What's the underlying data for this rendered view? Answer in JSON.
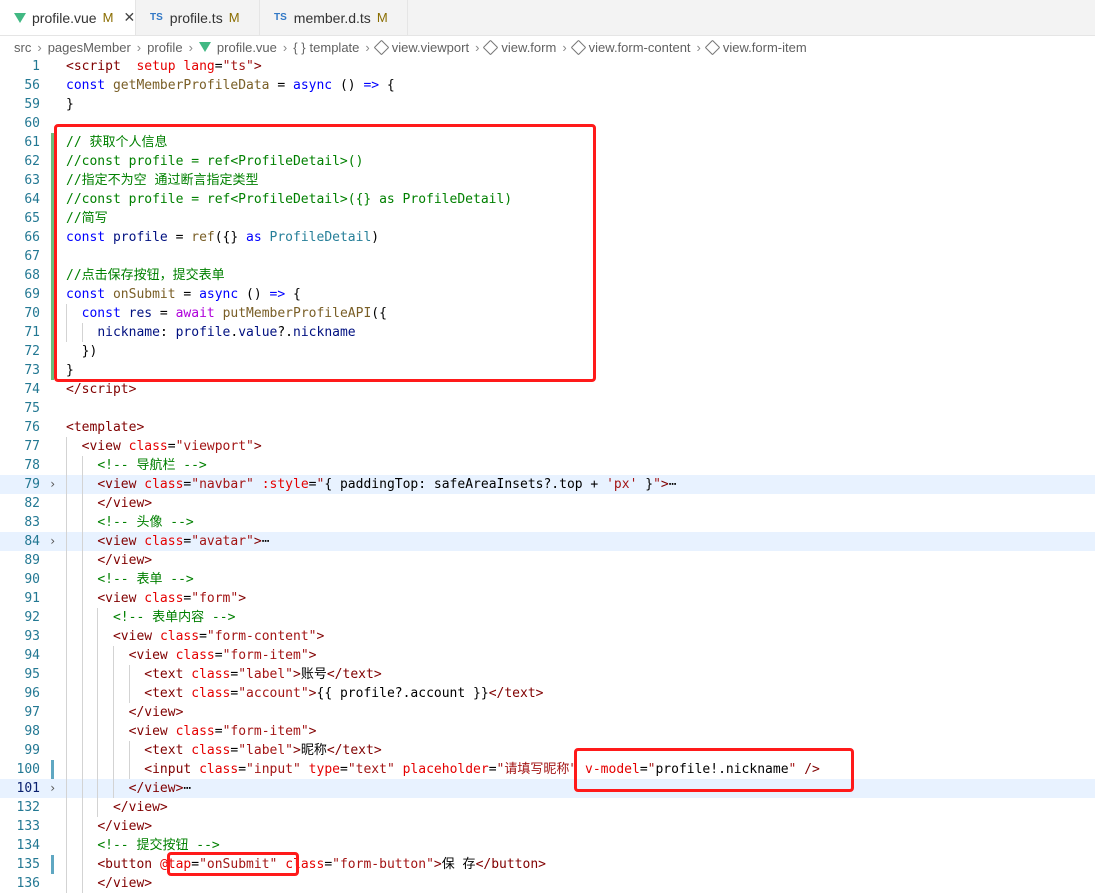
{
  "tabs": [
    {
      "label": "profile.vue",
      "status": "M",
      "icon": "vue-icon",
      "active": true
    },
    {
      "label": "profile.ts",
      "status": "M",
      "icon": "ts-icon",
      "active": false
    },
    {
      "label": "member.d.ts",
      "status": "M",
      "icon": "ts-icon",
      "active": false
    }
  ],
  "close_glyph": "✕",
  "breadcrumb": [
    "src",
    "pagesMember",
    "profile",
    "profile.vue",
    "template",
    "view.viewport",
    "view.form",
    "view.form-content",
    "view.form-item"
  ],
  "lines": [
    {
      "n": "1",
      "t": [
        [
          "tag",
          "<"
        ],
        [
          "tag",
          "script"
        ],
        [
          "",
          "  "
        ],
        [
          "attr",
          "setup"
        ],
        [
          "",
          " "
        ],
        [
          "attr",
          "lang"
        ],
        [
          "",
          "="
        ],
        [
          "str",
          "\"ts\""
        ],
        [
          "tag",
          ">"
        ]
      ]
    },
    {
      "n": "56",
      "t": [
        [
          "kw",
          "const"
        ],
        [
          "",
          " "
        ],
        [
          "fn",
          "getMemberProfileData"
        ],
        [
          "",
          " = "
        ],
        [
          "kw",
          "async"
        ],
        [
          "",
          " () "
        ],
        [
          "kw",
          "=>"
        ],
        [
          "",
          " {"
        ]
      ]
    },
    {
      "n": "59",
      "t": [
        [
          "",
          "}"
        ]
      ]
    },
    {
      "n": "60",
      "t": []
    },
    {
      "n": "61",
      "t": [
        [
          "cm",
          "// 获取个人信息"
        ]
      ]
    },
    {
      "n": "62",
      "t": [
        [
          "cm",
          "//const profile = ref<ProfileDetail>()"
        ]
      ]
    },
    {
      "n": "63",
      "t": [
        [
          "cm",
          "//指定不为空 通过断言指定类型"
        ]
      ]
    },
    {
      "n": "64",
      "t": [
        [
          "cm",
          "//const profile = ref<ProfileDetail>({} as ProfileDetail)"
        ]
      ]
    },
    {
      "n": "65",
      "t": [
        [
          "cm",
          "//简写"
        ]
      ]
    },
    {
      "n": "66",
      "t": [
        [
          "kw",
          "const"
        ],
        [
          "",
          " "
        ],
        [
          "va",
          "profile"
        ],
        [
          "",
          " = "
        ],
        [
          "fn",
          "ref"
        ],
        [
          "",
          "({} "
        ],
        [
          "kw",
          "as"
        ],
        [
          "",
          " "
        ],
        [
          "ty",
          "ProfileDetail"
        ],
        [
          "",
          ")"
        ]
      ]
    },
    {
      "n": "67",
      "t": []
    },
    {
      "n": "68",
      "t": [
        [
          "cm",
          "//点击保存按钮，提交表单"
        ]
      ]
    },
    {
      "n": "69",
      "t": [
        [
          "kw",
          "const"
        ],
        [
          "",
          " "
        ],
        [
          "fn",
          "onSubmit"
        ],
        [
          "",
          " = "
        ],
        [
          "kw",
          "async"
        ],
        [
          "",
          " () "
        ],
        [
          "kw",
          "=>"
        ],
        [
          "",
          " {"
        ]
      ]
    },
    {
      "n": "70",
      "t": [
        [
          "",
          "  "
        ],
        [
          "kw",
          "const"
        ],
        [
          "",
          " "
        ],
        [
          "va",
          "res"
        ],
        [
          "",
          " = "
        ],
        [
          "ctl",
          "await"
        ],
        [
          "",
          " "
        ],
        [
          "fn",
          "putMemberProfileAPI"
        ],
        [
          "",
          "({"
        ]
      ]
    },
    {
      "n": "71",
      "t": [
        [
          "",
          "    "
        ],
        [
          "va",
          "nickname"
        ],
        [
          "",
          ": "
        ],
        [
          "va",
          "profile"
        ],
        [
          "",
          "."
        ],
        [
          "va",
          "value"
        ],
        [
          "",
          "?."
        ],
        [
          "va",
          "nickname"
        ]
      ]
    },
    {
      "n": "72",
      "t": [
        [
          "",
          "  })"
        ]
      ]
    },
    {
      "n": "73",
      "t": [
        [
          "",
          "}"
        ]
      ]
    },
    {
      "n": "74",
      "t": [
        [
          "tag",
          "</"
        ],
        [
          "tag",
          "script"
        ],
        [
          "tag",
          ">"
        ]
      ]
    },
    {
      "n": "75",
      "t": []
    },
    {
      "n": "76",
      "t": [
        [
          "tag",
          "<template>"
        ]
      ]
    },
    {
      "n": "77",
      "t": [
        [
          "",
          "  "
        ],
        [
          "tag",
          "<view"
        ],
        [
          "",
          " "
        ],
        [
          "attr",
          "class"
        ],
        [
          "",
          "="
        ],
        [
          "str",
          "\"viewport\""
        ],
        [
          "tag",
          ">"
        ]
      ]
    },
    {
      "n": "78",
      "t": [
        [
          "",
          "    "
        ],
        [
          "cm",
          "<!-- 导航栏 -->"
        ]
      ]
    },
    {
      "n": "79",
      "t": [
        [
          "",
          "    "
        ],
        [
          "tag",
          "<view"
        ],
        [
          "",
          " "
        ],
        [
          "attr",
          "class"
        ],
        [
          "",
          "="
        ],
        [
          "str",
          "\"navbar\""
        ],
        [
          "",
          " "
        ],
        [
          "attr",
          ":style"
        ],
        [
          "",
          "="
        ],
        [
          "str",
          "\""
        ],
        [
          "",
          "{ paddingTop: safeAreaInsets?.top + "
        ],
        [
          "str",
          "'px'"
        ],
        [
          "",
          " }"
        ],
        [
          "str",
          "\""
        ],
        [
          "tag",
          ">"
        ],
        [
          "",
          "⋯"
        ]
      ]
    },
    {
      "n": "82",
      "t": [
        [
          "",
          "    "
        ],
        [
          "tag",
          "</view>"
        ]
      ]
    },
    {
      "n": "83",
      "t": [
        [
          "",
          "    "
        ],
        [
          "cm",
          "<!-- 头像 -->"
        ]
      ]
    },
    {
      "n": "84",
      "t": [
        [
          "",
          "    "
        ],
        [
          "tag",
          "<view"
        ],
        [
          "",
          " "
        ],
        [
          "attr",
          "class"
        ],
        [
          "",
          "="
        ],
        [
          "str",
          "\"avatar\""
        ],
        [
          "tag",
          ">"
        ],
        [
          "",
          "⋯"
        ]
      ]
    },
    {
      "n": "89",
      "t": [
        [
          "",
          "    "
        ],
        [
          "tag",
          "</view>"
        ]
      ]
    },
    {
      "n": "90",
      "t": [
        [
          "",
          "    "
        ],
        [
          "cm",
          "<!-- 表单 -->"
        ]
      ]
    },
    {
      "n": "91",
      "t": [
        [
          "",
          "    "
        ],
        [
          "tag",
          "<view"
        ],
        [
          "",
          " "
        ],
        [
          "attr",
          "class"
        ],
        [
          "",
          "="
        ],
        [
          "str",
          "\"form\""
        ],
        [
          "tag",
          ">"
        ]
      ]
    },
    {
      "n": "92",
      "t": [
        [
          "",
          "      "
        ],
        [
          "cm",
          "<!-- 表单内容 -->"
        ]
      ]
    },
    {
      "n": "93",
      "t": [
        [
          "",
          "      "
        ],
        [
          "tag",
          "<view"
        ],
        [
          "",
          " "
        ],
        [
          "attr",
          "class"
        ],
        [
          "",
          "="
        ],
        [
          "str",
          "\"form-content\""
        ],
        [
          "tag",
          ">"
        ]
      ]
    },
    {
      "n": "94",
      "t": [
        [
          "",
          "        "
        ],
        [
          "tag",
          "<view"
        ],
        [
          "",
          " "
        ],
        [
          "attr",
          "class"
        ],
        [
          "",
          "="
        ],
        [
          "str",
          "\"form-item\""
        ],
        [
          "tag",
          ">"
        ]
      ]
    },
    {
      "n": "95",
      "t": [
        [
          "",
          "          "
        ],
        [
          "tag",
          "<text"
        ],
        [
          "",
          " "
        ],
        [
          "attr",
          "class"
        ],
        [
          "",
          "="
        ],
        [
          "str",
          "\"label\""
        ],
        [
          "tag",
          ">"
        ],
        [
          "",
          "账号"
        ],
        [
          "tag",
          "</text>"
        ]
      ]
    },
    {
      "n": "96",
      "t": [
        [
          "",
          "          "
        ],
        [
          "tag",
          "<text"
        ],
        [
          "",
          " "
        ],
        [
          "attr",
          "class"
        ],
        [
          "",
          "="
        ],
        [
          "str",
          "\"account\""
        ],
        [
          "tag",
          ">"
        ],
        [
          "",
          "{{ profile?.account }}"
        ],
        [
          "tag",
          "</text>"
        ]
      ]
    },
    {
      "n": "97",
      "t": [
        [
          "",
          "        "
        ],
        [
          "tag",
          "</view>"
        ]
      ]
    },
    {
      "n": "98",
      "t": [
        [
          "",
          "        "
        ],
        [
          "tag",
          "<view"
        ],
        [
          "",
          " "
        ],
        [
          "attr",
          "class"
        ],
        [
          "",
          "="
        ],
        [
          "str",
          "\"form-item\""
        ],
        [
          "tag",
          ">"
        ]
      ]
    },
    {
      "n": "99",
      "t": [
        [
          "",
          "          "
        ],
        [
          "tag",
          "<text"
        ],
        [
          "",
          " "
        ],
        [
          "attr",
          "class"
        ],
        [
          "",
          "="
        ],
        [
          "str",
          "\"label\""
        ],
        [
          "tag",
          ">"
        ],
        [
          "",
          "昵称"
        ],
        [
          "tag",
          "</text>"
        ]
      ]
    },
    {
      "n": "100",
      "t": [
        [
          "",
          "          "
        ],
        [
          "tag",
          "<input"
        ],
        [
          "",
          " "
        ],
        [
          "attr",
          "class"
        ],
        [
          "",
          "="
        ],
        [
          "str",
          "\"input\""
        ],
        [
          "",
          " "
        ],
        [
          "attr",
          "type"
        ],
        [
          "",
          "="
        ],
        [
          "str",
          "\"text\""
        ],
        [
          "",
          " "
        ],
        [
          "attr",
          "placeholder"
        ],
        [
          "",
          "="
        ],
        [
          "str",
          "\"请填写昵称\""
        ],
        [
          "",
          " "
        ],
        [
          "attr",
          "v-model"
        ],
        [
          "",
          "="
        ],
        [
          "str",
          "\""
        ],
        [
          "",
          "profile!.nickname"
        ],
        [
          "str",
          "\""
        ],
        [
          "",
          " "
        ],
        [
          "tag",
          "/>"
        ]
      ]
    },
    {
      "n": "101",
      "t": [
        [
          "",
          "        "
        ],
        [
          "tag",
          "</view>"
        ],
        [
          "",
          "⋯"
        ]
      ]
    },
    {
      "n": "132",
      "t": [
        [
          "",
          "      "
        ],
        [
          "tag",
          "</view>"
        ]
      ]
    },
    {
      "n": "133",
      "t": [
        [
          "",
          "    "
        ],
        [
          "tag",
          "</view>"
        ]
      ]
    },
    {
      "n": "134",
      "t": [
        [
          "",
          "    "
        ],
        [
          "cm",
          "<!-- 提交按钮 -->"
        ]
      ]
    },
    {
      "n": "135",
      "t": [
        [
          "",
          "    "
        ],
        [
          "tag",
          "<button"
        ],
        [
          "",
          " "
        ],
        [
          "attr",
          "@tap"
        ],
        [
          "",
          "="
        ],
        [
          "str",
          "\"onSubmit\""
        ],
        [
          "",
          " "
        ],
        [
          "attr",
          "class"
        ],
        [
          "",
          "="
        ],
        [
          "str",
          "\"form-button\""
        ],
        [
          "tag",
          ">"
        ],
        [
          "",
          "保 存"
        ],
        [
          "tag",
          "</button>"
        ]
      ]
    },
    {
      "n": "136",
      "t": [
        [
          "",
          "    "
        ],
        [
          "tag",
          "</view>"
        ]
      ]
    }
  ],
  "folded_lines": [
    "79",
    "84",
    "101"
  ],
  "highlighted_lines": [
    "79",
    "84",
    "101"
  ],
  "current_line": "101",
  "green_gutter_lines": [
    "61",
    "62",
    "63",
    "64",
    "65",
    "66",
    "67",
    "68",
    "69",
    "70",
    "71",
    "72",
    "73"
  ],
  "blue_gutter_lines": [
    "100",
    "135"
  ],
  "fold_glyph": "›",
  "highlight_color": "#ff1a1a"
}
